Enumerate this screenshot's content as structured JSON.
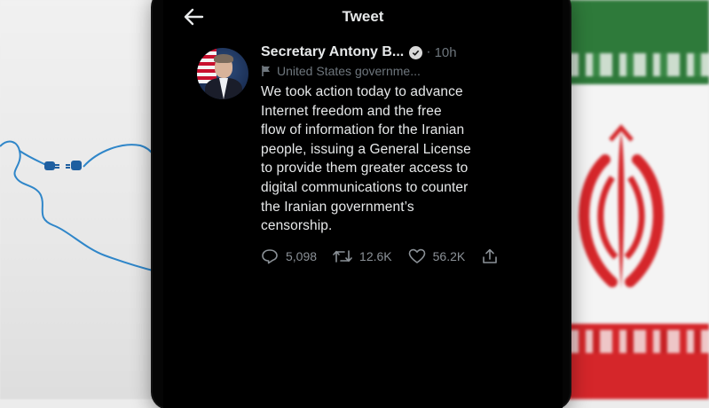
{
  "header": {
    "title": "Tweet"
  },
  "tweet": {
    "author_name": "Secretary Antony B...",
    "time": "10h",
    "account_label": "United States governme...",
    "text_lines": [
      "We took action today to advance",
      "Internet freedom and the free",
      "flow of information for the Iranian",
      "people, issuing a General License",
      "to provide them greater access to",
      "digital communications to counter",
      "the Iranian government’s",
      "censorship."
    ],
    "replies": "5,098",
    "retweets": "12.6K",
    "likes": "56.2K"
  },
  "colors": {
    "phone_bg": "#000000",
    "text": "#e7e9ea",
    "muted": "#6e767d",
    "flag_green": "#2e7a3a",
    "flag_red": "#d5262a",
    "map_line": "#2f86c9"
  },
  "icons": [
    "back-arrow-icon",
    "verified-icon",
    "flag-icon",
    "reply-icon",
    "retweet-icon",
    "like-icon",
    "share-icon",
    "plug-icon"
  ]
}
